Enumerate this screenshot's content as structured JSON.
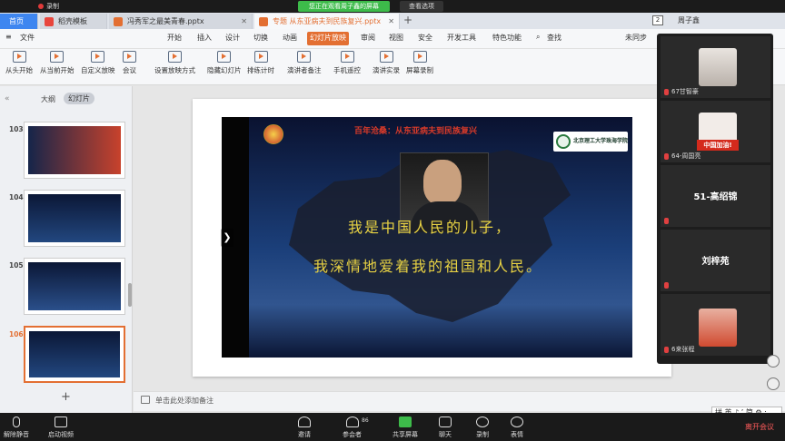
{
  "share_banner": {
    "status": "您正在观看周子鑫的屏幕",
    "view_options": "查看选项",
    "rec_label": "录制"
  },
  "tabs": {
    "home": "首页",
    "docer": "稻壳模板",
    "ppt1": "冯秀军之最美青春.pptx",
    "ppt2": "专题 从东亚病夫到民族复兴.pptx",
    "count": "2",
    "user": "周子鑫"
  },
  "menu": {
    "file": "文件",
    "items": [
      "开始",
      "插入",
      "设计",
      "切换",
      "动画",
      "幻灯片放映",
      "审阅",
      "视图",
      "安全",
      "开发工具",
      "特色功能",
      "查找"
    ],
    "cloud": "未同步"
  },
  "ribbon": [
    "从头开始",
    "从当前开始",
    "自定义放映",
    "会议",
    "设置放映方式",
    "隐藏幻灯片",
    "排练计时",
    "演讲者备注",
    "手机遥控",
    "演讲实录",
    "屏幕录制"
  ],
  "left_pane": {
    "outline": "大纲",
    "slides": "幻灯片",
    "slide_numbers": [
      "103",
      "104",
      "105",
      "106"
    ]
  },
  "slide": {
    "title": "百年沧桑：从东亚病夫到民族复兴",
    "school": "北京理工大学珠海学院",
    "quote_line1": "我是中国人民的儿子，",
    "quote_line2": "我深情地爱着我的祖国和人民。"
  },
  "notes": {
    "placeholder": "单击此处添加备注"
  },
  "participants": [
    {
      "name": "67甘智豪"
    },
    {
      "name": "64-周国亮",
      "badge": "中国加油!"
    },
    {
      "name": "51-高绍锦",
      "big": "51-高绍锦"
    },
    {
      "name": "",
      "big": "刘梓苑"
    },
    {
      "name": "6来张程"
    }
  ],
  "ime": "拼 英 ♪ ’ 简 ⚙ :",
  "meeting_toolbar": {
    "mute": "解除静音",
    "video": "启动视频",
    "invite": "邀请",
    "participants": "参会者",
    "participants_count": "86",
    "share": "共享屏幕",
    "chat": "聊天",
    "record": "录制",
    "reaction": "表情",
    "end": "离开会议"
  },
  "colors": {
    "accent": "#e36f32",
    "share_green": "#3dbb4a",
    "quote_yellow": "#e8d243"
  }
}
